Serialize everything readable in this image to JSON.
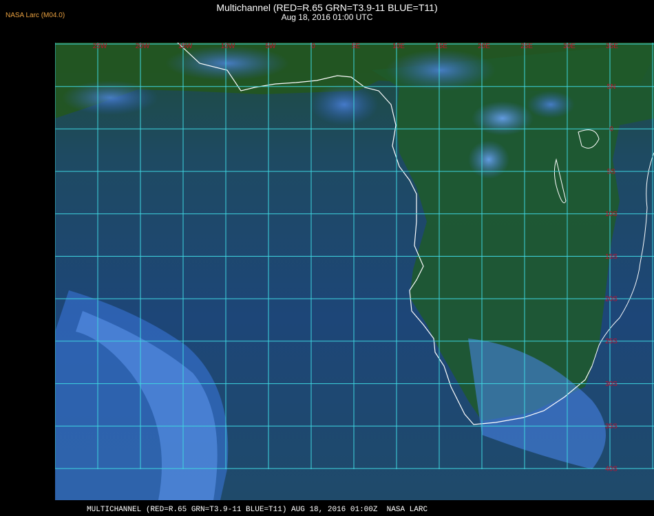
{
  "header": {
    "agency_badge": "NASA Larc (M04.0)",
    "title": "Multichannel (RED=R.65 GRN=T3.9-11 BLUE=T11)",
    "datetime": "Aug 18, 2016 01:00 UTC"
  },
  "map": {
    "lon_labels": [
      "25W",
      "20W",
      "15W",
      "10W",
      "5W",
      "0",
      "5E",
      "10E",
      "15E",
      "20E",
      "25E",
      "30E",
      "35E"
    ],
    "lat_labels": [
      "5N",
      "0",
      "5S",
      "10S",
      "15S",
      "20S",
      "25S",
      "30S",
      "35S",
      "40S"
    ],
    "colors": {
      "grid": "#3fd6e0",
      "labels": "#c8102e",
      "coast": "#ffffff",
      "ocean": "#1c4a7a",
      "land": "#1f5226"
    }
  },
  "footer": {
    "caption": "MULTICHANNEL (RED=R.65 GRN=T3.9-11 BLUE=T11) AUG 18, 2016 01:00Z  NASA LARC"
  }
}
